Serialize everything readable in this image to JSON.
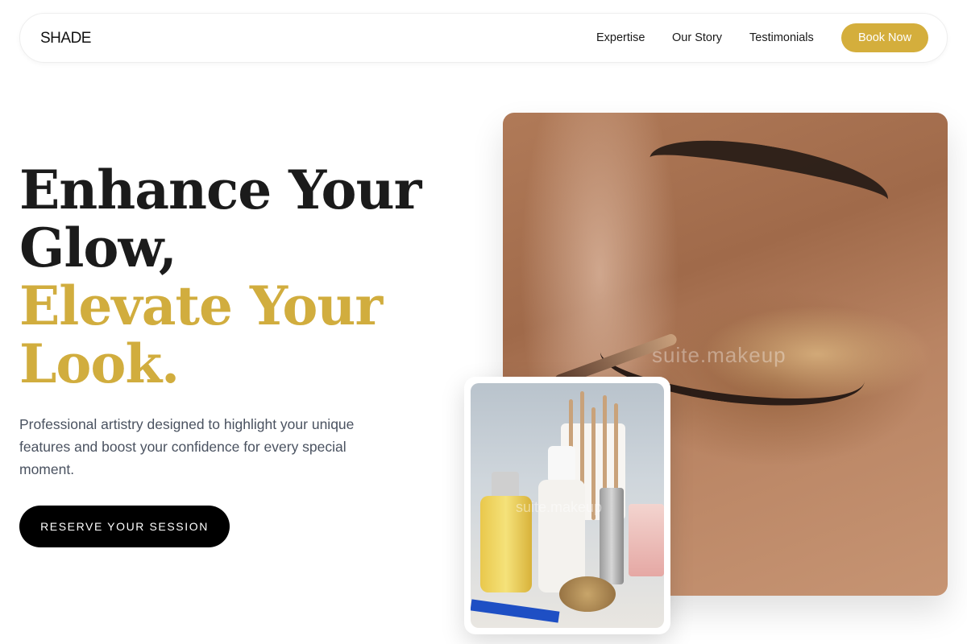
{
  "nav": {
    "logo": "SHADE",
    "links": [
      "Expertise",
      "Our Story",
      "Testimonials"
    ],
    "cta": "Book Now",
    "accent": "#d4ae3c"
  },
  "hero": {
    "headline_dark": [
      "Enhance Your",
      "Glow,"
    ],
    "headline_gold": [
      "Elevate Your",
      "Look."
    ],
    "subtext": "Professional artistry designed to highlight your unique features and boost your confidence for every special moment.",
    "cta": "RESERVE YOUR SESSION"
  },
  "images": {
    "main_watermark": "suite.makeup",
    "small_watermark": "suite.makeup"
  },
  "colors": {
    "gold": "#d1ad3e",
    "dark": "#1b1b1b",
    "subtext": "#4a5260",
    "cta_bg": "#000000"
  }
}
